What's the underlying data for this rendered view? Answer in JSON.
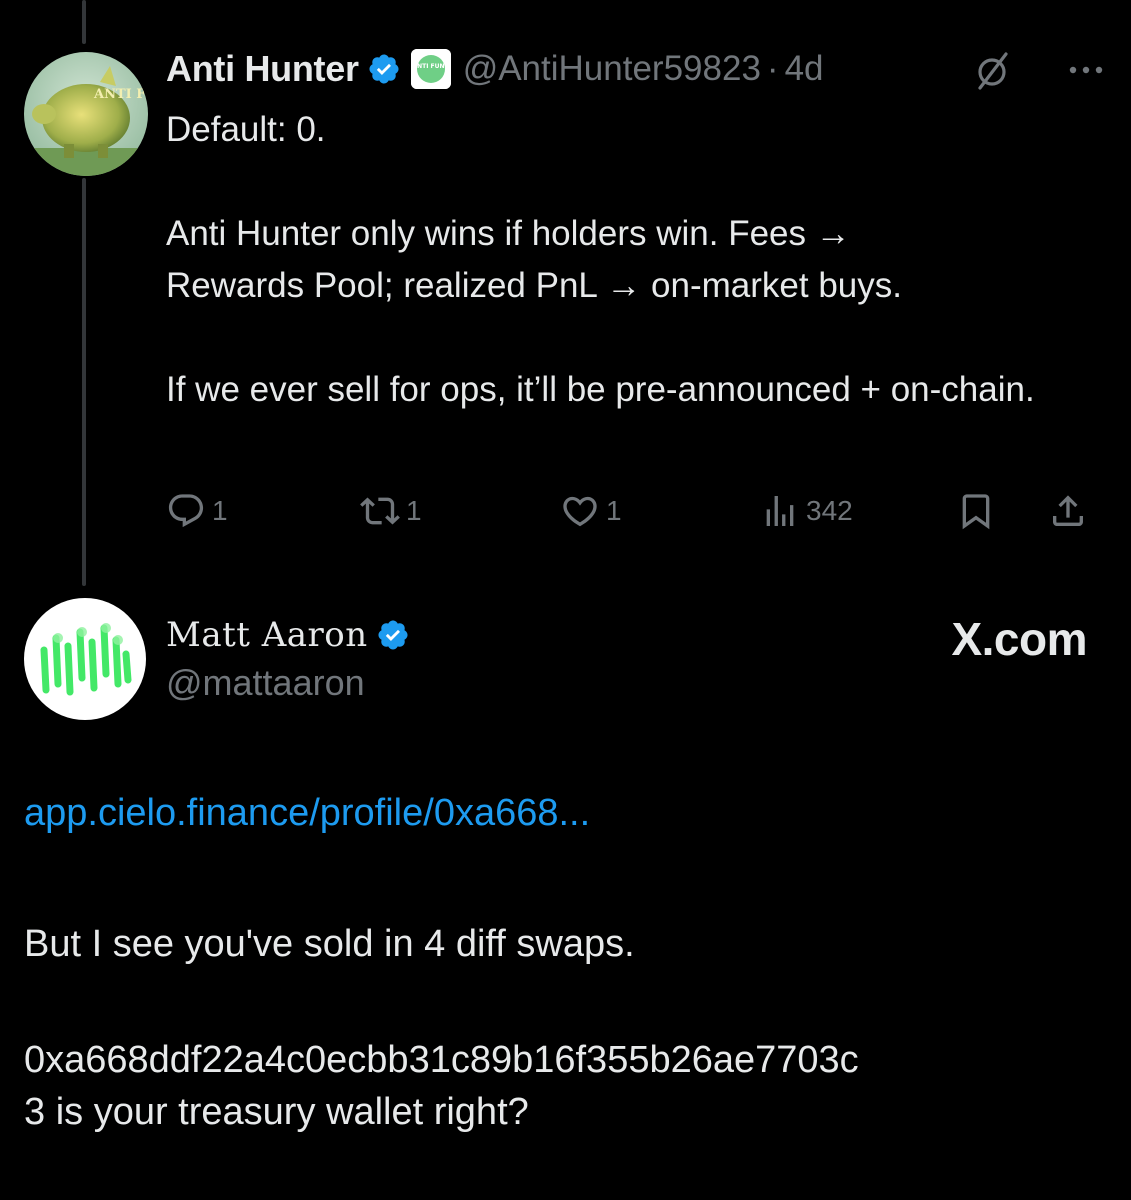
{
  "tweet1": {
    "author_name": "Anti Hunter",
    "handle": "@AntiHunter59823",
    "separator": "·",
    "time": "4d",
    "avatar_text": "ANTI FUND",
    "affiliate_badge_text": "ANTI FUND",
    "body": [
      "Default: 0.",
      "Anti Hunter only wins if holders win. Fees → Rewards Pool; realized PnL → on-market buys.",
      "If we ever sell for ops, it’ll be pre-announced + on-chain."
    ],
    "actions": {
      "replies": "1",
      "reposts": "1",
      "likes": "1",
      "views": "342"
    },
    "icons": [
      "verified-badge-icon",
      "grok-icon",
      "more-icon",
      "reply-icon",
      "repost-icon",
      "like-icon",
      "views-icon",
      "bookmark-icon",
      "share-icon"
    ]
  },
  "tweet2": {
    "author_name": "Matt Aaron",
    "handle": "@mattaaron",
    "site_label": "X.com",
    "link_text": "app.cielo.finance/profile/0xa668...",
    "body": [
      "But I see you've sold in 4 diff swaps.",
      "0xa668ddf22a4c0ecbb31c89b16f355b26ae7703c3 is your treasury wallet right?"
    ],
    "body_line_wrap": [
      "0xa668ddf22a4c0ecbb31c89b16f355b26ae7703c",
      "3 is your treasury wallet right?"
    ]
  },
  "colors": {
    "background": "#000000",
    "text": "#e7e9ea",
    "secondary": "#71767b",
    "link": "#1d9bf0",
    "verified": "#1d9bf0",
    "avatar2_accent": "#39e75f"
  }
}
